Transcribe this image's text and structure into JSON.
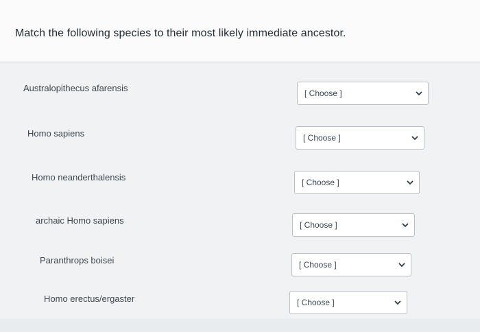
{
  "question": {
    "prompt": "Match the following species to their most likely immediate ancestor."
  },
  "matches": [
    {
      "term": "Australopithecus afarensis",
      "selected": "[ Choose ]"
    },
    {
      "term": "Homo sapiens",
      "selected": "[ Choose ]"
    },
    {
      "term": "Homo neanderthalensis",
      "selected": "[ Choose ]"
    },
    {
      "term": "archaic Homo sapiens",
      "selected": "[ Choose ]"
    },
    {
      "term": "Paranthrops boisei",
      "selected": "[ Choose ]"
    },
    {
      "term": "Homo erectus/ergaster",
      "selected": "[ Choose ]"
    }
  ],
  "icons": {
    "dropdown": "chevron-down-icon"
  }
}
